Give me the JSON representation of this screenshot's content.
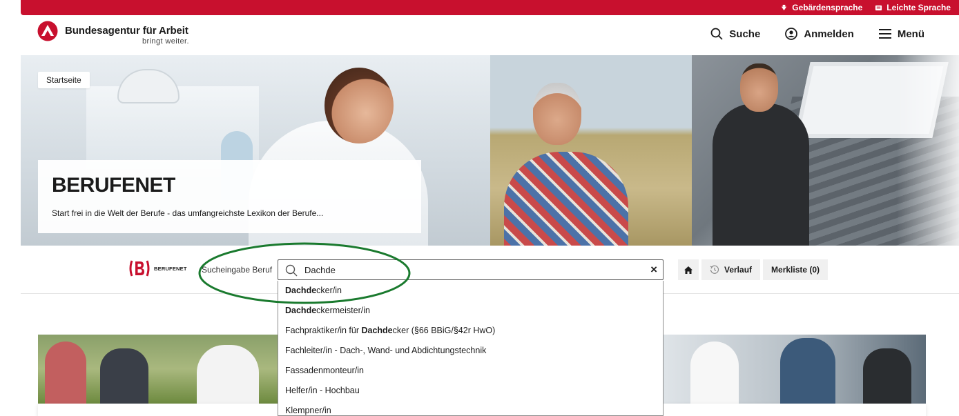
{
  "colors": {
    "brand_red": "#c8102e",
    "annotation_green": "#1a7a2e",
    "tool_bg": "#f0f0f0"
  },
  "topbar": {
    "links": [
      {
        "label": "Gebärdensprache",
        "icon": "sign-language-icon"
      },
      {
        "label": "Leichte Sprache",
        "icon": "easy-language-icon"
      }
    ]
  },
  "header": {
    "brand_name": "Bundesagentur für Arbeit",
    "brand_claim": "bringt weiter.",
    "nav": {
      "search": "Suche",
      "login": "Anmelden",
      "menu": "Menü"
    }
  },
  "hero": {
    "breadcrumb": "Startseite",
    "title": "BERUFENET",
    "subtitle": "Start frei in die Welt der Berufe - das umfangreichste Lexikon der Berufe..."
  },
  "toolbar": {
    "logo_text": "BERUFENET",
    "search_label": "Sucheingabe Beruf",
    "search_value": "Dachde",
    "clear_symbol": "×",
    "history_label": "Verlauf",
    "watchlist_label": "Merkliste (0)"
  },
  "suggestions": [
    {
      "match": "Dachde",
      "rest": "cker/in",
      "prefix": ""
    },
    {
      "match": "Dachde",
      "rest": "ckermeister/in",
      "prefix": ""
    },
    {
      "prefix": "Fachpraktiker/in für ",
      "match": "Dachde",
      "rest": "cker (§66 BBiG/§42r HwO)"
    },
    {
      "prefix": "Fachleiter/in - Dach-, Wand- und Abdichtungstechnik",
      "match": "",
      "rest": ""
    },
    {
      "prefix": "Fassadenmonteur/in",
      "match": "",
      "rest": ""
    },
    {
      "prefix": "Helfer/in - Hochbau",
      "match": "",
      "rest": ""
    },
    {
      "prefix": "Klempner/in",
      "match": "",
      "rest": ""
    }
  ]
}
